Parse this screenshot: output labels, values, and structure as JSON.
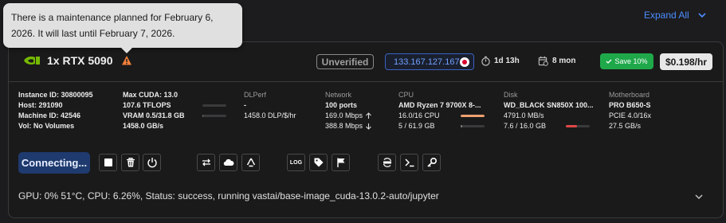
{
  "header": {
    "expand_all": "Expand All"
  },
  "tooltip": {
    "text": "There is a maintenance planned for February 6, 2026. It will last until February 7, 2026."
  },
  "card": {
    "gpu_name": "1x RTX 5090",
    "verification": "Unverified",
    "ip": "133.167.127.167",
    "duration": "1d 13h",
    "max_duration": "8 mon",
    "save_label": "Save 10%",
    "price": "$0.198/hr"
  },
  "details": {
    "instance": {
      "id": "Instance ID: 30800095",
      "host": "Host: 291090",
      "machine": "Machine ID: 42546",
      "volume": "Vol: No Volumes"
    },
    "compute": {
      "cuda": "Max CUDA: 13.0",
      "tflops": "107.6 TFLOPS",
      "vram": "VRAM 0.5/31.8 GB",
      "bandwidth": "1458.0 GB/s",
      "tflops_level": 0,
      "vram_level": 0.016
    },
    "dlperf": {
      "head": "DLPerf",
      "value": "-",
      "per_dollar": "1458.0 DLP/$/hr"
    },
    "network": {
      "head": "Network",
      "ports": "100 ports",
      "up": "169.0 Mbps",
      "down": "388.8 Mbps"
    },
    "cpu": {
      "head": "CPU",
      "model": "AMD Ryzen 7 9700X 8-...",
      "cores": "16.0/16 CPU",
      "ram": "5 / 61.9 GB",
      "cores_level": 1.0,
      "ram_level": 0.08
    },
    "disk": {
      "head": "Disk",
      "model": "WD_BLACK SN850X 100...",
      "speed": "4791.0 MB/s",
      "usage": "7.6 / 16.0 GB",
      "usage_level": 0.475
    },
    "motherboard": {
      "head": "Motherboard",
      "model": "PRO B650-S",
      "pcie": "PCIE 4.0/16x",
      "speed": "27.5 GB/s"
    }
  },
  "actions": {
    "connect_label": "Connecting...",
    "log_label": "LOG"
  },
  "status": {
    "text": "GPU: 0% 51°C, CPU: 6.26%, Status: success, running vastai/base-image_cuda-13.0.2-auto/jupyter"
  },
  "colors": {
    "accent": "#4c8dff",
    "warning": "#f07f3c",
    "save": "#1fa84a",
    "cpu_bar": "#f0a070",
    "disk_bar": "#e04848"
  }
}
